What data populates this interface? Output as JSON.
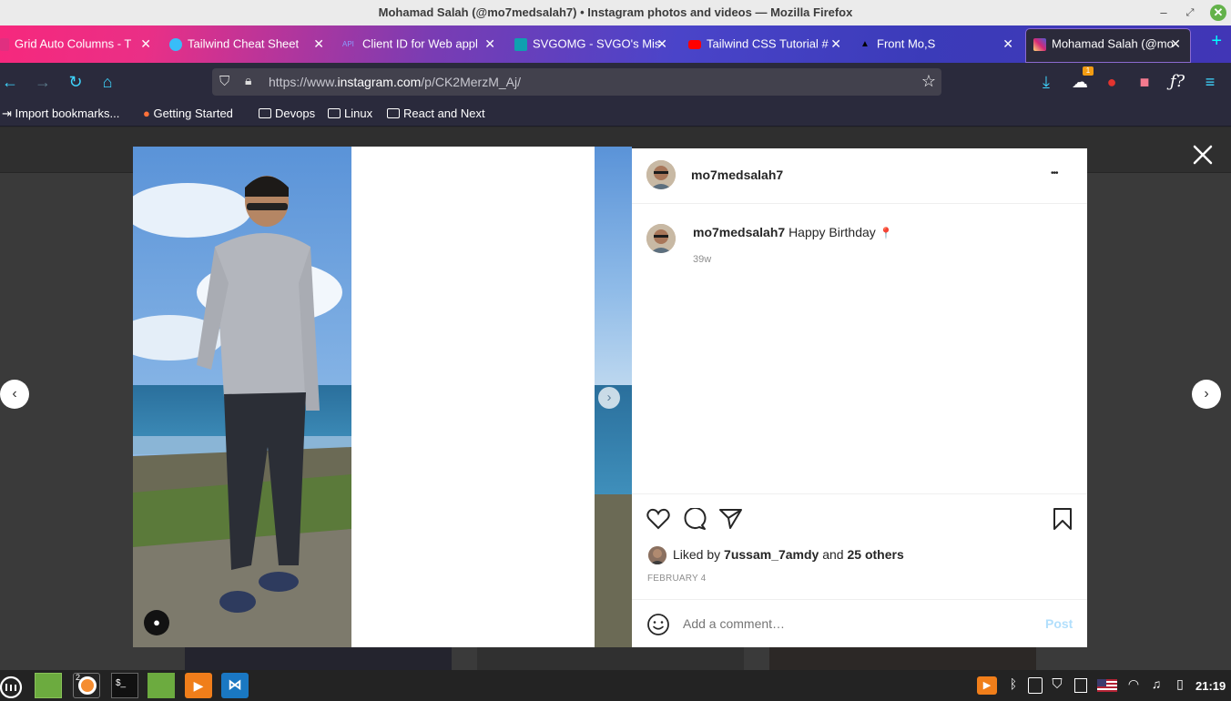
{
  "window": {
    "title": "Mohamad Salah (@mo7medsalah7) • Instagram photos and videos — Mozilla Firefox",
    "minimize": "–",
    "restore": "⤢",
    "close": "✕"
  },
  "tabs": [
    {
      "label": "Grid Auto Columns - T",
      "icon": "css-icon",
      "color": "#e02f80"
    },
    {
      "label": "Tailwind Cheat Sheet",
      "icon": "tailwind-icon",
      "color": "#38bdf8"
    },
    {
      "label": "Client ID for Web appl",
      "icon": "api-icon",
      "color": "#8a9cff"
    },
    {
      "label": "SVGOMG - SVGO's Mis",
      "icon": "svgomg-icon",
      "color": "#0fa0b0"
    },
    {
      "label": "Tailwind CSS Tutorial #",
      "icon": "youtube-icon",
      "color": "#ff0000"
    },
    {
      "label": "Front Mo,S",
      "icon": "vercel-icon",
      "color": "#000000"
    },
    {
      "label": "Mohamad Salah (@mo",
      "icon": "instagram-icon",
      "color": "#d6249f"
    }
  ],
  "url": {
    "prefix": "https://www.",
    "domain": "instagram.com",
    "path": "/p/CK2MerzM_Aj/"
  },
  "extension_badge": "1",
  "bookmarks": [
    {
      "label": "Import bookmarks...",
      "icon": "import-icon"
    },
    {
      "label": "Getting Started",
      "icon": "firefox-icon"
    },
    {
      "label": "Devops",
      "icon": "folder-icon"
    },
    {
      "label": "Linux",
      "icon": "folder-icon"
    },
    {
      "label": "React and Next",
      "icon": "folder-icon"
    }
  ],
  "post": {
    "username": "mo7medsalah7",
    "caption_user": "mo7medsalah7",
    "caption_text": "Happy Birthday",
    "caption_emoji": "📍",
    "age": "39w",
    "liked_prefix": "Liked by",
    "liked_user": "7ussam_7amdy",
    "liked_and": "and",
    "liked_others": "25 others",
    "date": "FEBRUARY 4",
    "comment_placeholder": "Add a comment…",
    "post_button": "Post",
    "more_menu": "•••"
  },
  "taskbar": {
    "clock": "21:19",
    "firefox_badge": "2"
  },
  "colors": {
    "instagram_blue": "#0095f6",
    "post_button_disabled": "#b2dffc",
    "taskbar_bg": "#232323"
  }
}
